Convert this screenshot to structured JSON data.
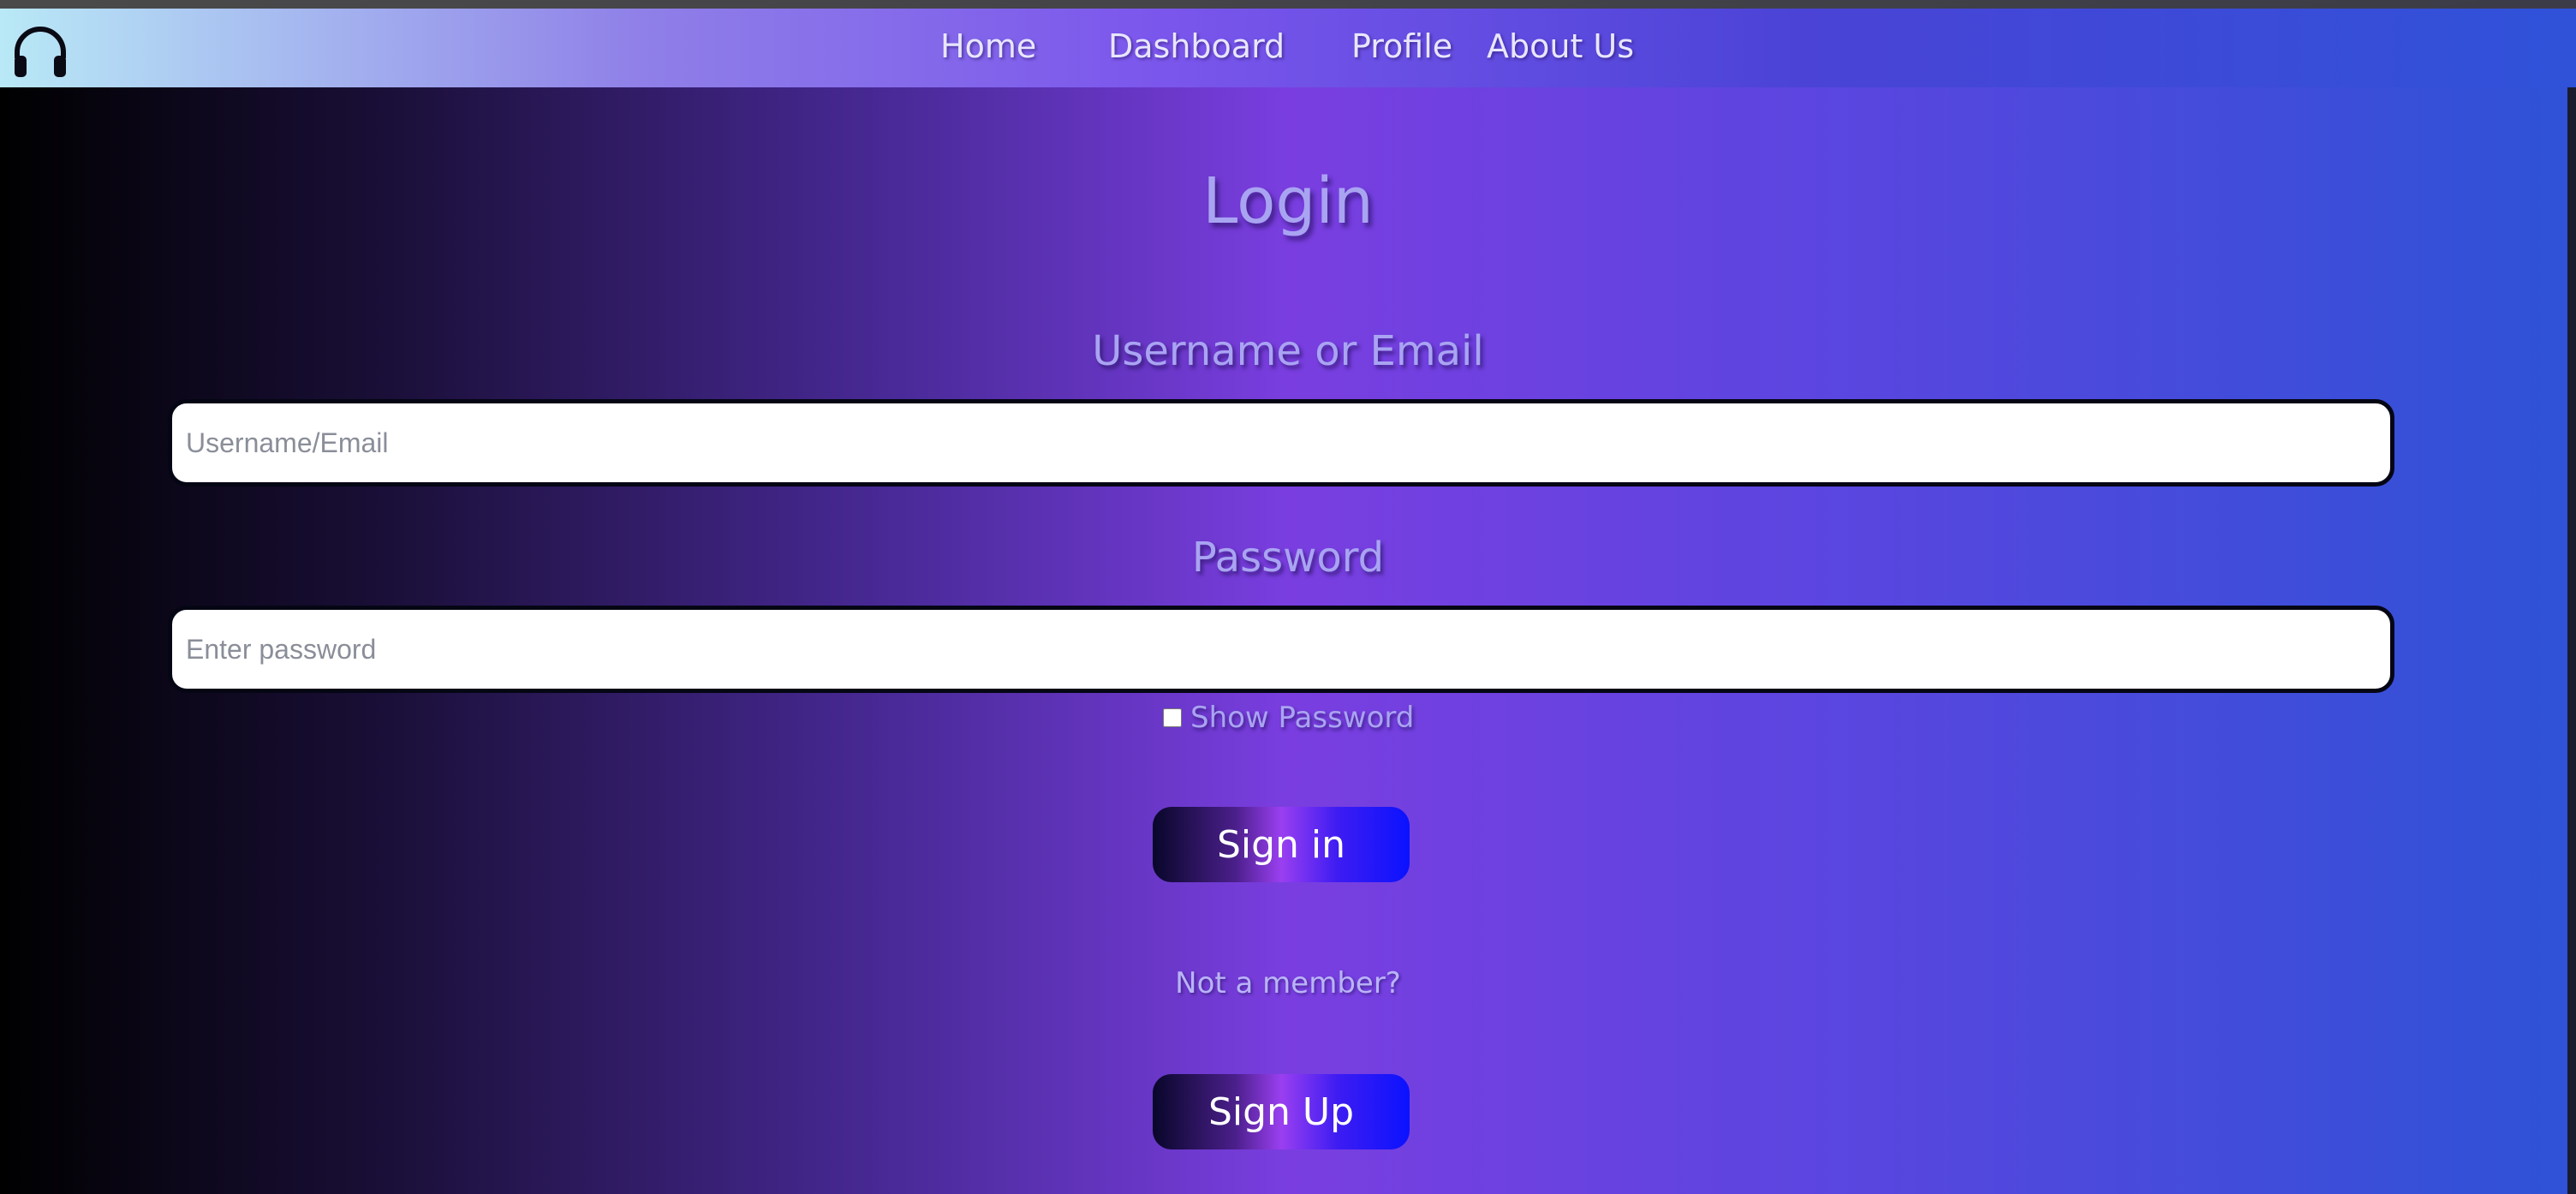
{
  "nav": {
    "logo_icon": "headphones-icon",
    "links": [
      "Home",
      "Dashboard",
      "Profile",
      "About Us"
    ]
  },
  "login": {
    "title": "Login",
    "username_label": "Username or Email",
    "username_placeholder": "Username/Email",
    "username_value": "",
    "password_label": "Password",
    "password_placeholder": "Enter password",
    "password_value": "",
    "show_password_label": "Show Password",
    "show_password_checked": false,
    "sign_in_label": "Sign in",
    "not_member_text": "Not a member?",
    "sign_up_label": "Sign Up"
  },
  "colors": {
    "button_gradient_start": "#08062a",
    "button_gradient_mid": "#9a3ff0",
    "button_gradient_end": "#0b12ff",
    "label_color": "#a9a4f2"
  }
}
